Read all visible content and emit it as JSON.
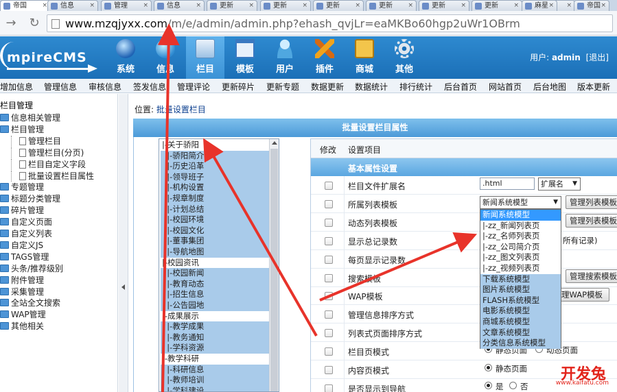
{
  "browser": {
    "tabs": [
      {
        "title": "帝国",
        "active": true
      },
      {
        "title": "信息"
      },
      {
        "title": "管理"
      },
      {
        "title": "信息"
      },
      {
        "title": "更新"
      },
      {
        "title": "更新"
      },
      {
        "title": "更新"
      },
      {
        "title": "更新"
      },
      {
        "title": "更新"
      },
      {
        "title": "更新"
      },
      {
        "title": "更新"
      },
      {
        "title": "麻星"
      },
      {
        "title": "帝国"
      }
    ],
    "url_host": "www.mzqjyxx.com",
    "url_path": "/m/e/admin/admin.php?ehash_qvjLr=eaMKBo60hgp2uWr1OBrm"
  },
  "header": {
    "logo_text": "mpireCMS",
    "nav": [
      {
        "label": "系统",
        "icon": "globe-icon"
      },
      {
        "label": "信息",
        "icon": "info-icon"
      },
      {
        "label": "栏目",
        "icon": "folder-icon",
        "active": true
      },
      {
        "label": "模板",
        "icon": "template-icon"
      },
      {
        "label": "用户",
        "icon": "user-icon"
      },
      {
        "label": "插件",
        "icon": "plugin-icon"
      },
      {
        "label": "商城",
        "icon": "shop-icon"
      },
      {
        "label": "其他",
        "icon": "gear-icon"
      }
    ],
    "user_label": "用户:",
    "user_name": "admin",
    "logout": "[退出]"
  },
  "submenu": [
    "增加信息",
    "管理信息",
    "审核信息",
    "签发信息",
    "管理评论",
    "更新碎片",
    "更新专题",
    "数据更新",
    "数据统计",
    "排行统计",
    "后台首页",
    "网站首页",
    "后台地图",
    "版本更新"
  ],
  "sidebar": {
    "title": "栏目管理",
    "items": [
      {
        "label": "信息相关管理",
        "type": "folder"
      },
      {
        "label": "栏目管理",
        "type": "folder-open"
      },
      {
        "label": "管理栏目",
        "type": "doc"
      },
      {
        "label": "管理栏目(分页)",
        "type": "doc"
      },
      {
        "label": "栏目自定义字段",
        "type": "doc"
      },
      {
        "label": "批量设置栏目属性",
        "type": "doc"
      },
      {
        "label": "专题管理",
        "type": "folder"
      },
      {
        "label": "标题分类管理",
        "type": "folder"
      },
      {
        "label": "碎片管理",
        "type": "folder"
      },
      {
        "label": "自定义页面",
        "type": "folder"
      },
      {
        "label": "自定义列表",
        "type": "folder"
      },
      {
        "label": "自定义JS",
        "type": "folder"
      },
      {
        "label": "TAGS管理",
        "type": "folder"
      },
      {
        "label": "头条/推荐级别",
        "type": "folder"
      },
      {
        "label": "附件管理",
        "type": "folder"
      },
      {
        "label": "采集管理",
        "type": "folder"
      },
      {
        "label": "全站全文搜索",
        "type": "folder"
      },
      {
        "label": "WAP管理",
        "type": "folder"
      },
      {
        "label": "其他相关",
        "type": "folder"
      }
    ]
  },
  "content": {
    "crumb_prefix": "位置:",
    "crumb_link": "批量设置栏目",
    "panel_title": "批量设置栏目属性",
    "categories": [
      {
        "label": "|-关于骄阳",
        "sel": false
      },
      {
        "label": "  |-骄阳简介",
        "sel": true
      },
      {
        "label": "  |-历史沿革",
        "sel": true
      },
      {
        "label": "  |-领导班子",
        "sel": true
      },
      {
        "label": "  |-机构设置",
        "sel": true
      },
      {
        "label": "  |-规章制度",
        "sel": true
      },
      {
        "label": "  |-计划总结",
        "sel": true
      },
      {
        "label": "  |-校园环境",
        "sel": true
      },
      {
        "label": "  |-校园文化",
        "sel": true
      },
      {
        "label": "  |-董事集团",
        "sel": true
      },
      {
        "label": "  |-导航地图",
        "sel": true
      },
      {
        "label": "|-校园资讯",
        "sel": false
      },
      {
        "label": "  |-校园新闻",
        "sel": true
      },
      {
        "label": "  |-教育动态",
        "sel": true
      },
      {
        "label": "  |-招生信息",
        "sel": true
      },
      {
        "label": "  |-公告园地",
        "sel": true
      },
      {
        "label": "|-成果展示",
        "sel": false
      },
      {
        "label": "  |-教学成果",
        "sel": true
      },
      {
        "label": "  |-教务通知",
        "sel": true
      },
      {
        "label": "  |-学科资源",
        "sel": true
      },
      {
        "label": "|-教学科研",
        "sel": false
      },
      {
        "label": "  |-科研信息",
        "sel": true
      },
      {
        "label": "  |-教师培训",
        "sel": true
      },
      {
        "label": "  |-学科建设",
        "sel": true
      }
    ],
    "table_head": {
      "col1": "修改",
      "col2": "设置项目"
    },
    "section_title": "基本属性设置",
    "rows": [
      "栏目文件扩展名",
      "所属列表模板",
      "动态列表模板",
      "显示总记录数",
      "每页显示记录数",
      "搜索模板",
      "WAP模板",
      "管理信息排序方式",
      "列表式页面排序方式",
      "栏目页模式",
      "内容页模式",
      "是否显示到导航"
    ],
    "ext_value": ".html",
    "ext_select": "扩展名",
    "list_tpl_select": "新闻系统模型",
    "btn_list_tpl": "管理列表模板",
    "btn_dyn_tpl": "管理列表模板",
    "all_records_hint": "所有记录)",
    "btn_search_tpl": "管理搜索模板",
    "btn_wap_tpl": "理WAP模板",
    "listpage_opt1": "静态页面",
    "listpage_opt2": "动态页面",
    "content_opt1": "静态页面",
    "nav_opt1": "是",
    "nav_opt2": "否"
  },
  "dropdown": {
    "options": [
      {
        "label": "新闻系统模型",
        "kind": "hl"
      },
      {
        "label": "|-zz_新闻列表页",
        "kind": "item"
      },
      {
        "label": "|-zz_名师列表页",
        "kind": "item"
      },
      {
        "label": "|-zz_公司简介页",
        "kind": "item"
      },
      {
        "label": "|-zz_图文列表页",
        "kind": "item"
      },
      {
        "label": "|-zz_视频列表页",
        "kind": "item"
      },
      {
        "label": "下载系统模型",
        "kind": "grp"
      },
      {
        "label": "图片系统模型",
        "kind": "grp"
      },
      {
        "label": "FLASH系统模型",
        "kind": "grp"
      },
      {
        "label": "电影系统模型",
        "kind": "grp"
      },
      {
        "label": "商城系统模型",
        "kind": "grp"
      },
      {
        "label": "文章系统模型",
        "kind": "grp"
      },
      {
        "label": "分类信息系统模型",
        "kind": "grp"
      }
    ]
  },
  "watermark": {
    "main": "开发兔",
    "sub": "www.kaifatu.com"
  },
  "colors": {
    "header": "#1b6fb7",
    "accent": "#3399ff",
    "annotation": "#e8332a"
  }
}
